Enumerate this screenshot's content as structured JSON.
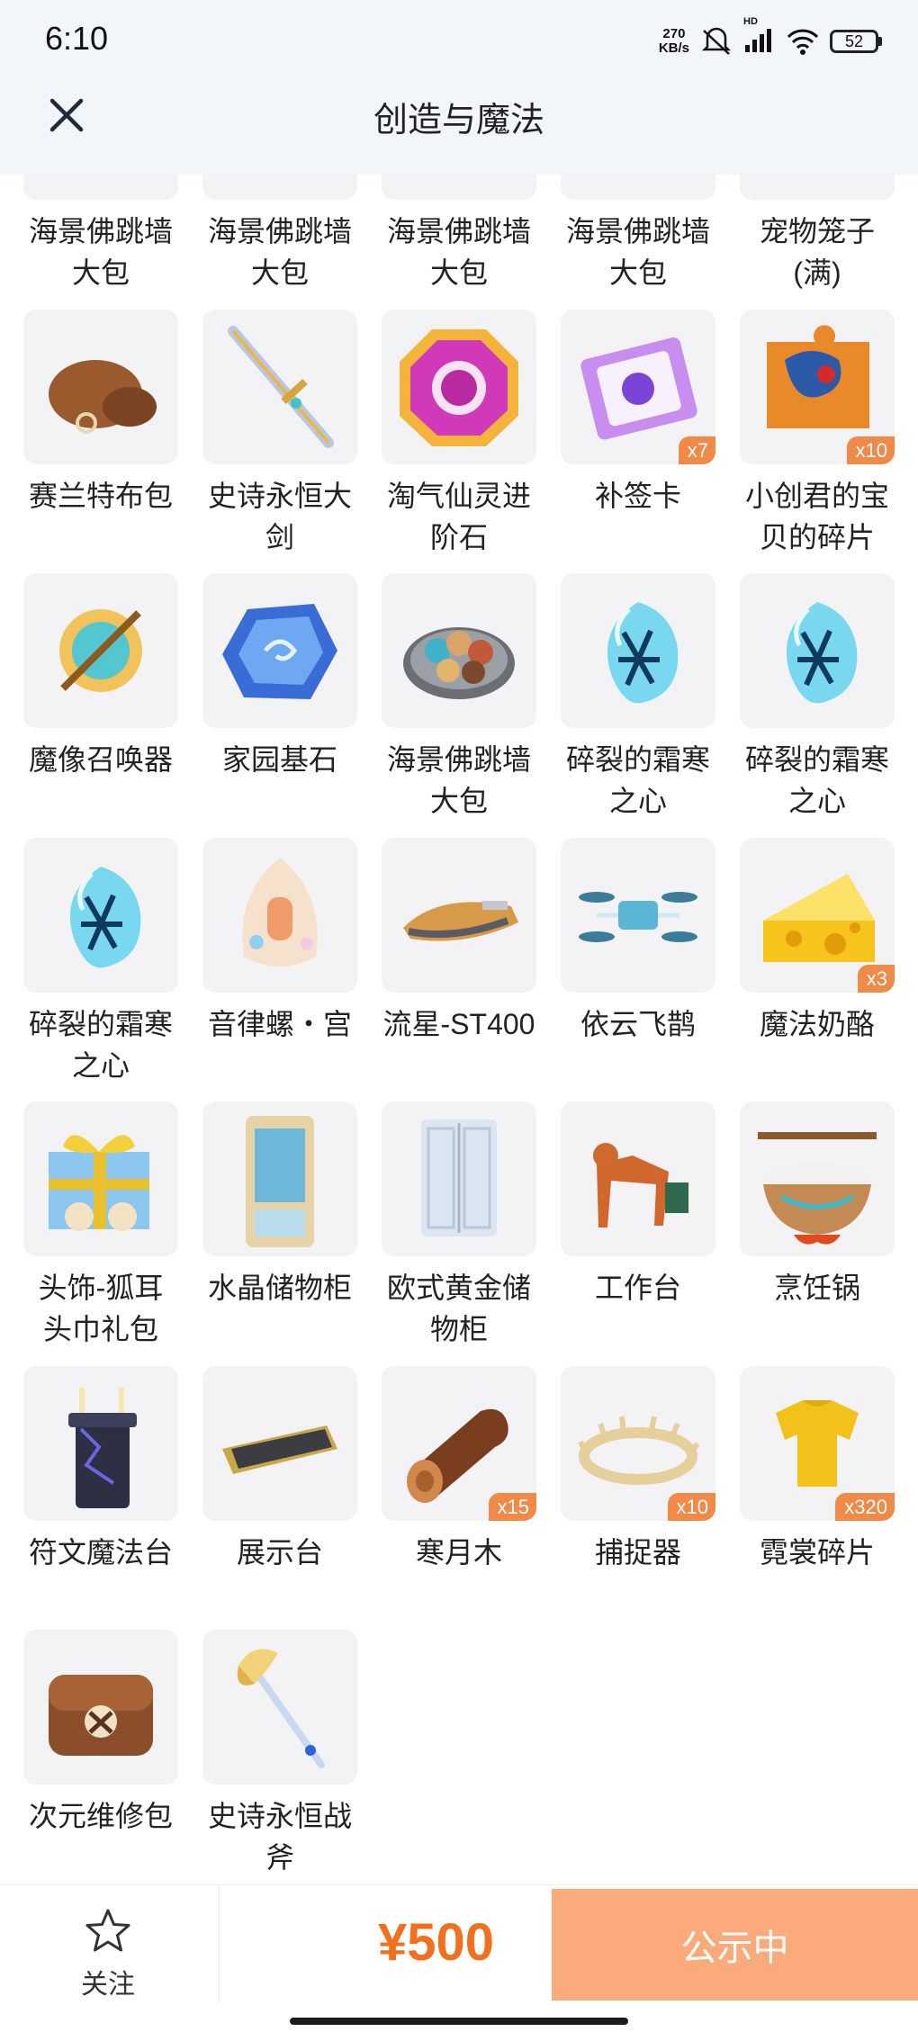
{
  "status_bar": {
    "time": "6:10",
    "net_speed_value": "270",
    "net_speed_unit": "KB/s",
    "network_label": "HD",
    "battery": "52"
  },
  "header": {
    "title": "创造与魔法",
    "close_icon": "close-icon"
  },
  "items": [
    {
      "name": "海景佛跳墙\n大包",
      "qty": "",
      "icon": "food-plate"
    },
    {
      "name": "海景佛跳墙\n大包",
      "qty": "",
      "icon": "food-plate"
    },
    {
      "name": "海景佛跳墙\n大包",
      "qty": "",
      "icon": "food-plate"
    },
    {
      "name": "海景佛跳墙\n大包",
      "qty": "",
      "icon": "food-plate"
    },
    {
      "name": "宠物笼子\n(满)",
      "qty": "",
      "icon": "pet-cage"
    },
    {
      "name": "赛兰特布包",
      "qty": "",
      "icon": "cloth-bag"
    },
    {
      "name": "史诗永恒大\n剑",
      "qty": "",
      "icon": "sword"
    },
    {
      "name": "淘气仙灵进\n阶石",
      "qty": "",
      "icon": "gem"
    },
    {
      "name": "补签卡",
      "qty": "x7",
      "icon": "ticket"
    },
    {
      "name": "小创君的宝\n贝的碎片",
      "qty": "x10",
      "icon": "puzzle"
    },
    {
      "name": "魔像召唤器",
      "qty": "",
      "icon": "summoner"
    },
    {
      "name": "家园基石",
      "qty": "",
      "icon": "stone"
    },
    {
      "name": "海景佛跳墙\n大包",
      "qty": "",
      "icon": "food-plate"
    },
    {
      "name": "碎裂的霜寒\n之心",
      "qty": "",
      "icon": "ice-heart"
    },
    {
      "name": "碎裂的霜寒\n之心",
      "qty": "",
      "icon": "ice-heart"
    },
    {
      "name": "碎裂的霜寒\n之心",
      "qty": "",
      "icon": "ice-heart"
    },
    {
      "name": "音律螺・宫",
      "qty": "",
      "icon": "conch"
    },
    {
      "name": "流星-ST400",
      "qty": "",
      "icon": "hoverbike"
    },
    {
      "name": "依云飞鹊",
      "qty": "",
      "icon": "drone"
    },
    {
      "name": "魔法奶酪",
      "qty": "x3",
      "icon": "cheese"
    },
    {
      "name": "头饰-狐耳\n头巾礼包",
      "qty": "",
      "icon": "gift-box"
    },
    {
      "name": "水晶储物柜",
      "qty": "",
      "icon": "crystal-cabinet"
    },
    {
      "name": "欧式黄金储\n物柜",
      "qty": "",
      "icon": "wardrobe"
    },
    {
      "name": "工作台",
      "qty": "",
      "icon": "workbench"
    },
    {
      "name": "烹饪锅",
      "qty": "",
      "icon": "cooking-pot"
    },
    {
      "name": "符文魔法台",
      "qty": "",
      "icon": "rune-altar"
    },
    {
      "name": "展示台",
      "qty": "",
      "icon": "display-stand"
    },
    {
      "name": "寒月木",
      "qty": "x15",
      "icon": "log"
    },
    {
      "name": "捕捉器",
      "qty": "x10",
      "icon": "trap"
    },
    {
      "name": "霓裳碎片",
      "qty": "x320",
      "icon": "shirt"
    },
    {
      "name": "次元维修包",
      "qty": "",
      "icon": "repair-bag"
    },
    {
      "name": "史诗永恒战\n斧",
      "qty": "",
      "icon": "axe"
    }
  ],
  "bottom_bar": {
    "follow_label": "关注",
    "price": "¥500",
    "action_label": "公示中"
  },
  "colors": {
    "accent": "#f0701f",
    "action_bg": "#fbab7b",
    "qty_badge": "#f08a48",
    "thumb_bg": "#f3f3f5"
  }
}
